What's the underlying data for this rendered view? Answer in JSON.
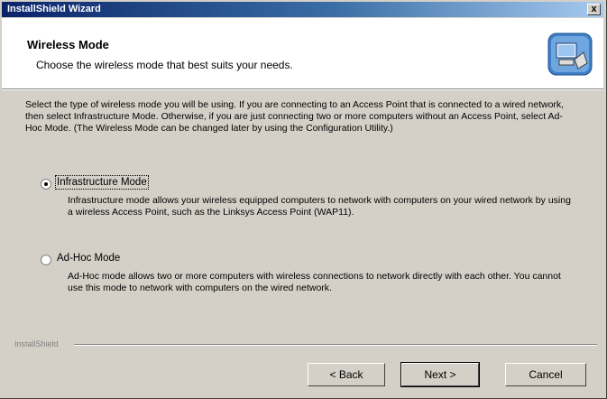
{
  "window": {
    "title": "InstallShield Wizard",
    "close_label": "x"
  },
  "header": {
    "title": "Wireless Mode",
    "subtitle": "Choose the wireless mode that best suits your needs.",
    "icon": "computer-setup-icon"
  },
  "body": {
    "intro": "Select the type of wireless mode you will be using. If you are connecting to an Access Point that is connected to a wired network, then select Infrastructure Mode. Otherwise, if you are just connecting two or more computers without an Access Point, select Ad-Hoc Mode. (The Wireless Mode can be changed later by using the Configuration Utility.)"
  },
  "options": [
    {
      "label": "Infrastructure Mode",
      "selected": true,
      "description": "Infrastructure mode allows your wireless equipped computers to network with computers on your wired network by using a wireless Access Point, such as the Linksys Access Point (WAP11)."
    },
    {
      "label": "Ad-Hoc Mode",
      "selected": false,
      "description": "Ad-Hoc mode allows two or more computers with wireless connections to network directly with each other. You cannot use this mode to network with computers on the wired network."
    }
  ],
  "footer": {
    "brand": "InstallShield",
    "back_label": "< Back",
    "next_label": "Next >",
    "cancel_label": "Cancel"
  },
  "colors": {
    "title_bar_start": "#0a246a",
    "title_bar_end": "#a6caf0",
    "dialog_face": "#d4d0c8"
  }
}
